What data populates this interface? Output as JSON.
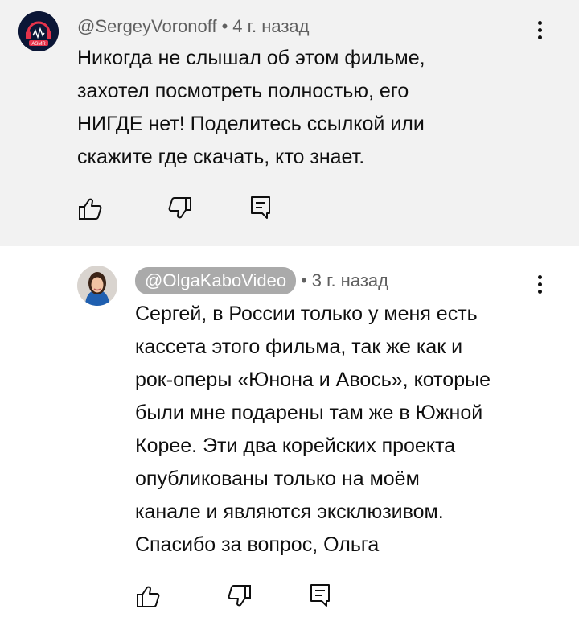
{
  "comments": [
    {
      "handle": "@SergeyVoronoff",
      "separator": "•",
      "time": "4 г. назад",
      "lines": [
        "Никогда не слышал об этом фильме,",
        "захотел посмотреть полностью, его",
        "НИГДЕ нет! Поделитесь ссылкой или",
        "скажите где скачать, кто знает."
      ],
      "avatar_text": "ASMR",
      "avatar_icon": "headphones-logo",
      "colors": {
        "background": "#f2f2f2",
        "avatar_bg": "#0b1636",
        "avatar_accent": "#e5334b"
      }
    },
    {
      "handle": "@OlgaKaboVideo",
      "separator": "•",
      "time": "3 г. назад",
      "lines": [
        "Сергей, в России только у меня есть",
        "кассета этого фильма, так же как и",
        "рок-оперы «Юнона и Авось», которые",
        "были мне подарены там же в Южной",
        "Корее. Эти два корейских проекта",
        "опубликованы только на моём",
        "канале  и являются эксклюзивом.",
        "Спасибо за вопрос, Ольга"
      ],
      "avatar_icon": "profile-photo",
      "colors": {
        "background": "#ffffff",
        "pill": "#aaaaaa"
      }
    }
  ],
  "icons": {
    "like": "thumbs-up-icon",
    "dislike": "thumbs-down-icon",
    "reply": "reply-icon",
    "more": "more-vertical-icon"
  }
}
